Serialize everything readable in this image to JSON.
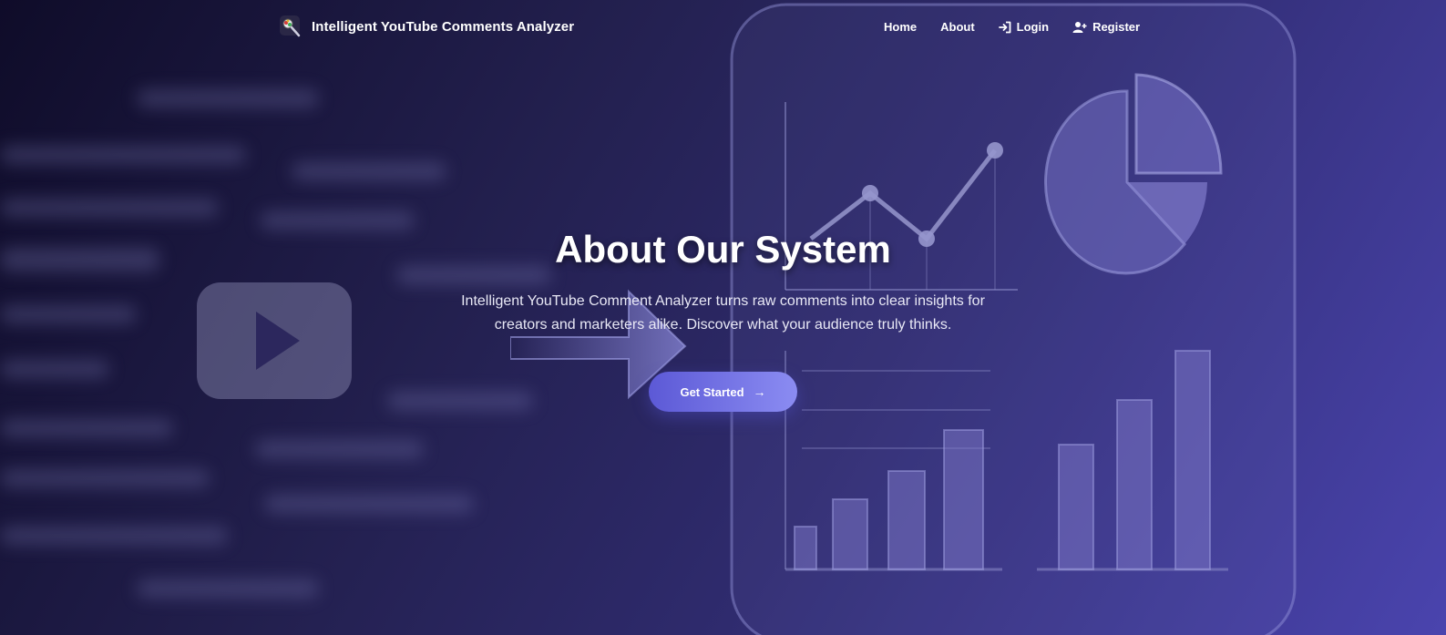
{
  "brand": {
    "title": "Intelligent YouTube Comments Analyzer",
    "icon": "brand-logo-icon"
  },
  "nav": {
    "home": "Home",
    "about": "About",
    "login": "Login",
    "register": "Register"
  },
  "hero": {
    "title": "About Our System",
    "text": "Intelligent YouTube Comment Analyzer turns raw comments into clear insights for creators and marketers alike. Discover what your audience truly thinks.",
    "cta_label": "Get Started",
    "cta_icon": "arrow-right-icon"
  },
  "colors": {
    "bg_start": "#0f0c29",
    "bg_end": "#4a44ae",
    "cta_start": "#5c59d6",
    "cta_end": "#8b8cf2"
  }
}
